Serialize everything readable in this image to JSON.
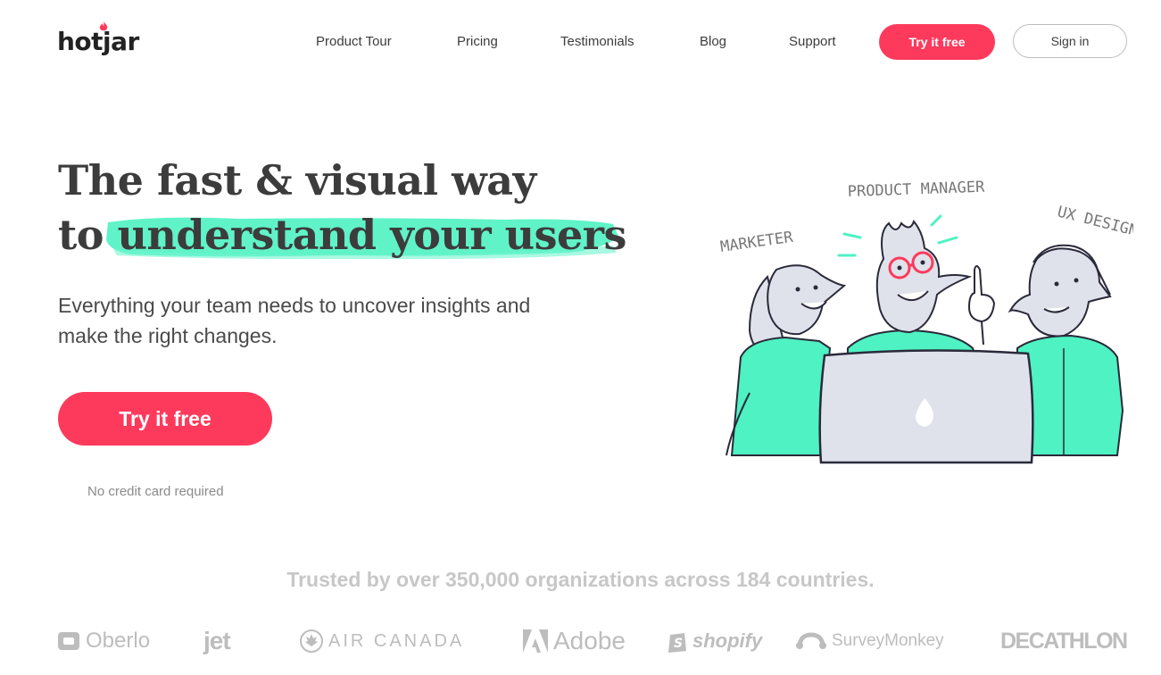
{
  "header": {
    "logo_text": "hotjar",
    "nav": [
      "Product Tour",
      "Pricing",
      "Testimonials",
      "Blog",
      "Support"
    ],
    "try_label": "Try it free",
    "signin_label": "Sign in"
  },
  "hero": {
    "headline_line1": "The fast & visual way",
    "headline_to": "to",
    "headline_highlight": "understand your users",
    "subhead": "Everything your team needs to uncover insights and make the right changes.",
    "cta_label": "Try it free",
    "cta_note": "No credit card required"
  },
  "illustration": {
    "labels": [
      "MARKETER",
      "PRODUCT MANAGER",
      "UX DESIGNER"
    ]
  },
  "trust": {
    "text": "Trusted by over 350,000 organizations across 184 countries.",
    "brands": [
      "Oberlo",
      "jet",
      "AIR CANADA",
      "Adobe",
      "shopify",
      "SurveyMonkey",
      "DECATHLON"
    ]
  },
  "colors": {
    "accent": "#fd3a5c",
    "highlight": "#4ff2c2",
    "muted_logo": "#bdbdbd"
  }
}
